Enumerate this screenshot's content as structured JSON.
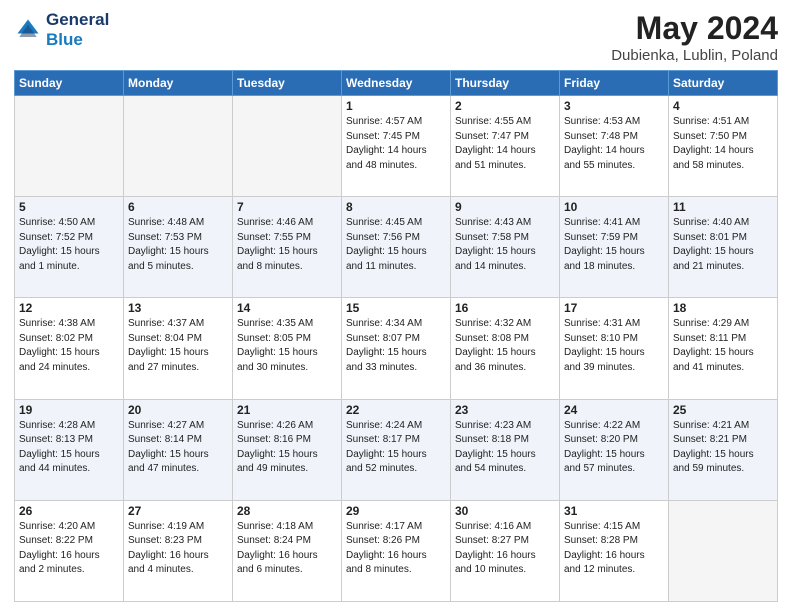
{
  "header": {
    "logo_line1": "General",
    "logo_line2": "Blue",
    "main_title": "May 2024",
    "subtitle": "Dubienka, Lublin, Poland"
  },
  "weekdays": [
    "Sunday",
    "Monday",
    "Tuesday",
    "Wednesday",
    "Thursday",
    "Friday",
    "Saturday"
  ],
  "weeks": [
    [
      {
        "day": "",
        "info": ""
      },
      {
        "day": "",
        "info": ""
      },
      {
        "day": "",
        "info": ""
      },
      {
        "day": "1",
        "info": "Sunrise: 4:57 AM\nSunset: 7:45 PM\nDaylight: 14 hours\nand 48 minutes."
      },
      {
        "day": "2",
        "info": "Sunrise: 4:55 AM\nSunset: 7:47 PM\nDaylight: 14 hours\nand 51 minutes."
      },
      {
        "day": "3",
        "info": "Sunrise: 4:53 AM\nSunset: 7:48 PM\nDaylight: 14 hours\nand 55 minutes."
      },
      {
        "day": "4",
        "info": "Sunrise: 4:51 AM\nSunset: 7:50 PM\nDaylight: 14 hours\nand 58 minutes."
      }
    ],
    [
      {
        "day": "5",
        "info": "Sunrise: 4:50 AM\nSunset: 7:52 PM\nDaylight: 15 hours\nand 1 minute."
      },
      {
        "day": "6",
        "info": "Sunrise: 4:48 AM\nSunset: 7:53 PM\nDaylight: 15 hours\nand 5 minutes."
      },
      {
        "day": "7",
        "info": "Sunrise: 4:46 AM\nSunset: 7:55 PM\nDaylight: 15 hours\nand 8 minutes."
      },
      {
        "day": "8",
        "info": "Sunrise: 4:45 AM\nSunset: 7:56 PM\nDaylight: 15 hours\nand 11 minutes."
      },
      {
        "day": "9",
        "info": "Sunrise: 4:43 AM\nSunset: 7:58 PM\nDaylight: 15 hours\nand 14 minutes."
      },
      {
        "day": "10",
        "info": "Sunrise: 4:41 AM\nSunset: 7:59 PM\nDaylight: 15 hours\nand 18 minutes."
      },
      {
        "day": "11",
        "info": "Sunrise: 4:40 AM\nSunset: 8:01 PM\nDaylight: 15 hours\nand 21 minutes."
      }
    ],
    [
      {
        "day": "12",
        "info": "Sunrise: 4:38 AM\nSunset: 8:02 PM\nDaylight: 15 hours\nand 24 minutes."
      },
      {
        "day": "13",
        "info": "Sunrise: 4:37 AM\nSunset: 8:04 PM\nDaylight: 15 hours\nand 27 minutes."
      },
      {
        "day": "14",
        "info": "Sunrise: 4:35 AM\nSunset: 8:05 PM\nDaylight: 15 hours\nand 30 minutes."
      },
      {
        "day": "15",
        "info": "Sunrise: 4:34 AM\nSunset: 8:07 PM\nDaylight: 15 hours\nand 33 minutes."
      },
      {
        "day": "16",
        "info": "Sunrise: 4:32 AM\nSunset: 8:08 PM\nDaylight: 15 hours\nand 36 minutes."
      },
      {
        "day": "17",
        "info": "Sunrise: 4:31 AM\nSunset: 8:10 PM\nDaylight: 15 hours\nand 39 minutes."
      },
      {
        "day": "18",
        "info": "Sunrise: 4:29 AM\nSunset: 8:11 PM\nDaylight: 15 hours\nand 41 minutes."
      }
    ],
    [
      {
        "day": "19",
        "info": "Sunrise: 4:28 AM\nSunset: 8:13 PM\nDaylight: 15 hours\nand 44 minutes."
      },
      {
        "day": "20",
        "info": "Sunrise: 4:27 AM\nSunset: 8:14 PM\nDaylight: 15 hours\nand 47 minutes."
      },
      {
        "day": "21",
        "info": "Sunrise: 4:26 AM\nSunset: 8:16 PM\nDaylight: 15 hours\nand 49 minutes."
      },
      {
        "day": "22",
        "info": "Sunrise: 4:24 AM\nSunset: 8:17 PM\nDaylight: 15 hours\nand 52 minutes."
      },
      {
        "day": "23",
        "info": "Sunrise: 4:23 AM\nSunset: 8:18 PM\nDaylight: 15 hours\nand 54 minutes."
      },
      {
        "day": "24",
        "info": "Sunrise: 4:22 AM\nSunset: 8:20 PM\nDaylight: 15 hours\nand 57 minutes."
      },
      {
        "day": "25",
        "info": "Sunrise: 4:21 AM\nSunset: 8:21 PM\nDaylight: 15 hours\nand 59 minutes."
      }
    ],
    [
      {
        "day": "26",
        "info": "Sunrise: 4:20 AM\nSunset: 8:22 PM\nDaylight: 16 hours\nand 2 minutes."
      },
      {
        "day": "27",
        "info": "Sunrise: 4:19 AM\nSunset: 8:23 PM\nDaylight: 16 hours\nand 4 minutes."
      },
      {
        "day": "28",
        "info": "Sunrise: 4:18 AM\nSunset: 8:24 PM\nDaylight: 16 hours\nand 6 minutes."
      },
      {
        "day": "29",
        "info": "Sunrise: 4:17 AM\nSunset: 8:26 PM\nDaylight: 16 hours\nand 8 minutes."
      },
      {
        "day": "30",
        "info": "Sunrise: 4:16 AM\nSunset: 8:27 PM\nDaylight: 16 hours\nand 10 minutes."
      },
      {
        "day": "31",
        "info": "Sunrise: 4:15 AM\nSunset: 8:28 PM\nDaylight: 16 hours\nand 12 minutes."
      },
      {
        "day": "",
        "info": ""
      }
    ]
  ]
}
